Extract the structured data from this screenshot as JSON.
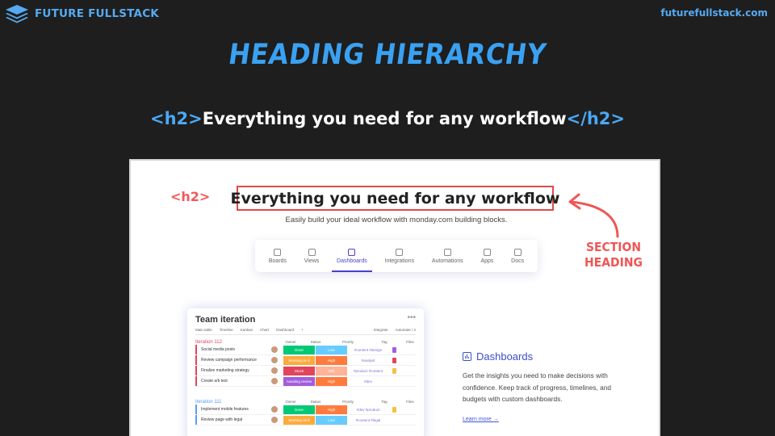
{
  "brand": {
    "name": "FUTURE FULLSTACK",
    "url": "futurefullstack.com"
  },
  "slide": {
    "title": "HEADING HIERARCHY",
    "code": {
      "open_tag": "<h2>",
      "text": "Everything you need for any workflow",
      "close_tag": "</h2>"
    }
  },
  "screenshot": {
    "h2_label": "<h2>",
    "heading": "Everything you need for any workflow",
    "subtitle": "Easily build your ideal workflow with monday.com building blocks.",
    "annotation": [
      "SECTION",
      "HEADING"
    ],
    "tabs": [
      {
        "label": "Boards",
        "active": false
      },
      {
        "label": "Views",
        "active": false
      },
      {
        "label": "Dashboards",
        "active": true
      },
      {
        "label": "Integrations",
        "active": false
      },
      {
        "label": "Automations",
        "active": false
      },
      {
        "label": "Apps",
        "active": false
      },
      {
        "label": "Docs",
        "active": false
      }
    ],
    "board": {
      "title": "Team iteration",
      "views": [
        "Main table",
        "Timeline",
        "Kanban",
        "Chart",
        "Dashboard",
        "+"
      ],
      "views_right": [
        "Integrate",
        "Automate / 2"
      ],
      "columns": [
        "Owner",
        "Status",
        "Priority",
        "Tag",
        "Files"
      ],
      "groups": [
        {
          "title": "Iteration 112",
          "color": "#e2445c",
          "rows": [
            {
              "name": "Social media posts",
              "status": "Done",
              "status_color": "#00c875",
              "priority": "Low",
              "priority_color": "#66ccff",
              "tag": "#content #design",
              "file_color": "#a25ddc"
            },
            {
              "name": "Review campaign performance",
              "status": "Working on it",
              "status_color": "#fdab3d",
              "priority": "High",
              "priority_color": "#ff7b3d",
              "tag": "#analyst",
              "file_color": "#e2445c"
            },
            {
              "name": "Finalize marketing strategy",
              "status": "Stuck",
              "status_color": "#e2445c",
              "priority": "Mid",
              "priority_color": "#ffb399",
              "tag": "#product #content",
              "file_color": "#f5c242"
            },
            {
              "name": "Create a/b test",
              "status": "Awaiting review",
              "status_color": "#a25ddc",
              "priority": "High",
              "priority_color": "#ff7b3d",
              "tag": "#dev",
              "file_color": ""
            }
          ]
        },
        {
          "title": "Iteration 111",
          "color": "#579bfc",
          "rows": [
            {
              "name": "Implement mobile features",
              "status": "Done",
              "status_color": "#00c875",
              "priority": "High",
              "priority_color": "#ff7b3d",
              "tag": "#dev #product",
              "file_color": "#f5c242"
            },
            {
              "name": "Review page with legal",
              "status": "Working on it",
              "status_color": "#fdab3d",
              "priority": "Low",
              "priority_color": "#66ccff",
              "tag": "#content #legal",
              "file_color": ""
            }
          ]
        }
      ]
    },
    "feature": {
      "title": "Dashboards",
      "description": "Get the insights you need to make decisions with confidence. Keep track of progress, timelines, and budgets with custom dashboards.",
      "link": "Learn more →"
    }
  }
}
